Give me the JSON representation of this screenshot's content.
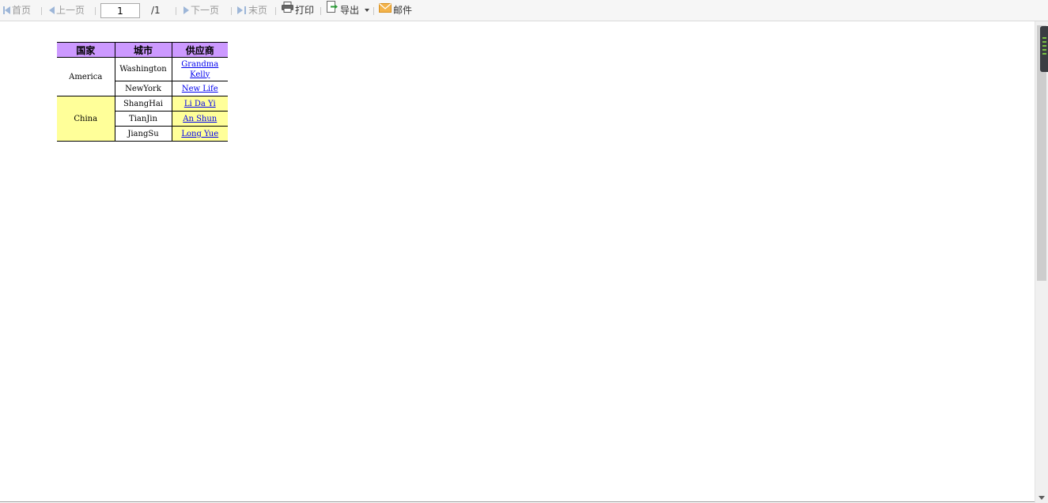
{
  "toolbar": {
    "first_label": "首页",
    "prev_label": "上一页",
    "page_value": "1",
    "page_total": "/1",
    "next_label": "下一页",
    "last_label": "末页",
    "print_label": "打印",
    "export_label": "导出",
    "mail_label": "邮件"
  },
  "report": {
    "headers": [
      "国家",
      "城市",
      "供应商"
    ],
    "groups": [
      {
        "country": "America",
        "rows": [
          {
            "city": "Washington",
            "supplier_line1": "Grandma",
            "supplier_line2": "Kelly"
          },
          {
            "city": "NewYork",
            "supplier_line1": "New Life"
          }
        ]
      },
      {
        "country": "China",
        "rows": [
          {
            "city": "ShangHai",
            "supplier_line1": "Li Da Yi"
          },
          {
            "city": "TianJin",
            "supplier_line1": "An Shun"
          },
          {
            "city": "JiangSu",
            "supplier_line1": "Long Yue"
          }
        ]
      }
    ]
  },
  "colors": {
    "header_bg": "#cc99ff",
    "china_bg": "#ffff99",
    "link": "#0000ee",
    "nav_icon": "#9db6d8"
  }
}
